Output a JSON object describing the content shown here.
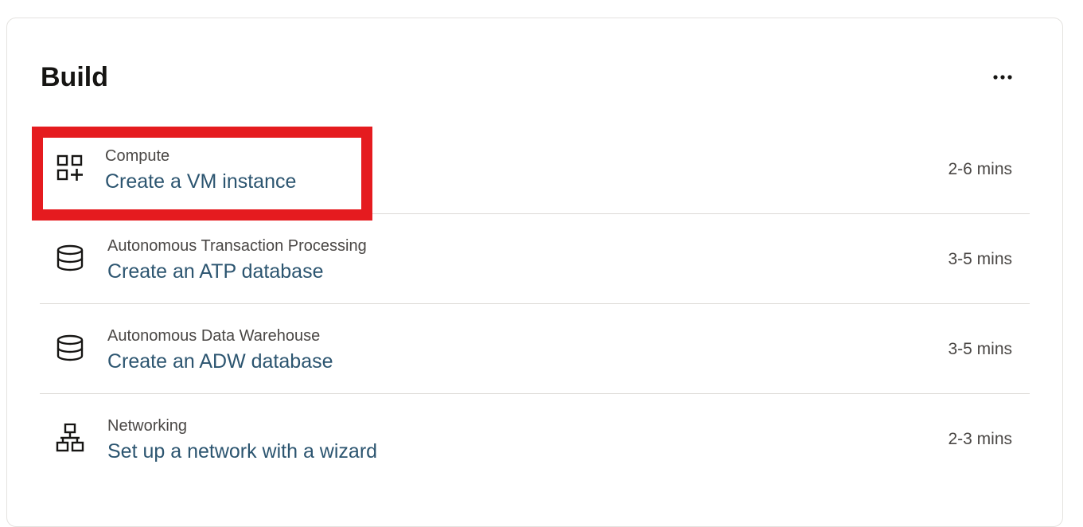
{
  "panel": {
    "title": "Build",
    "more_icon": "more-horizontal-icon"
  },
  "items": [
    {
      "category": "Compute",
      "action": "Create a VM instance",
      "duration": "2-6 mins",
      "icon": "grid-add-icon"
    },
    {
      "category": "Autonomous Transaction Processing",
      "action": "Create an ATP database",
      "duration": "3-5 mins",
      "icon": "database-icon"
    },
    {
      "category": "Autonomous Data Warehouse",
      "action": "Create an ADW database",
      "duration": "3-5 mins",
      "icon": "database-icon"
    },
    {
      "category": "Networking",
      "action": "Set up a network with a wizard",
      "duration": "2-3 mins",
      "icon": "network-icon"
    }
  ],
  "colors": {
    "link": "#2c5570",
    "highlight": "#e51b1f",
    "text": "#161513",
    "muted": "#4a4745"
  }
}
